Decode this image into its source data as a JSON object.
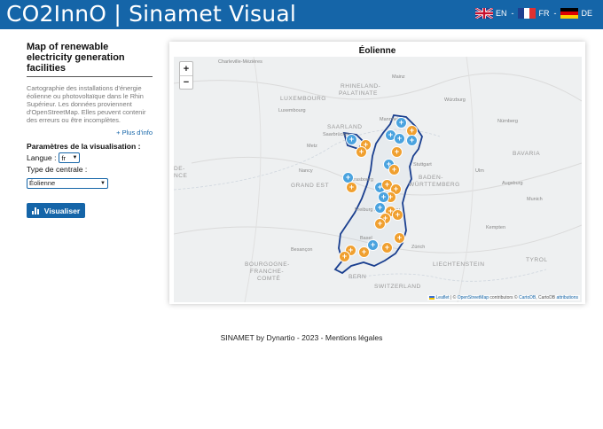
{
  "header": {
    "title": "CO2InnO | Sinamet Visual",
    "languages": [
      {
        "code": "EN",
        "flag": "uk-flag-icon"
      },
      {
        "code": "FR",
        "flag": "france-flag-icon"
      },
      {
        "code": "DE",
        "flag": "germany-flag-icon"
      }
    ],
    "separator": "-"
  },
  "sidebar": {
    "heading": "Map of renewable electricity generation facilities",
    "description": "Cartographie des installations d'énergie éolienne ou photovoltaïque dans le Rhin Supérieur. Les données proviennent d'OpenStreetMap. Elles peuvent contenir des erreurs ou être incomplètes.",
    "more_link": "+ Plus d'info",
    "params_title": "Paramètres de la visualisation :",
    "lang_label": "Langue :",
    "lang_value": "fr",
    "type_label": "Type de centrale :",
    "type_value": "Éolienne",
    "button_label": "Visualiser"
  },
  "map": {
    "title": "Éolienne",
    "zoom_in": "+",
    "zoom_out": "−",
    "labels": {
      "charleville": "Charleville-Mézières",
      "luxembourg_region": "LUXEMBOURG",
      "luxembourg": "Luxembourg",
      "rhineland": "RHINELAND-",
      "palatinate": "PALATINATE",
      "mainz": "Mainz",
      "wurzburg": "Würzburg",
      "saarland": "SAARLAND",
      "saarbrucken": "Saarbrücken",
      "nurnberg": "Nürnberg",
      "mannheim": "Mannheim",
      "metz": "Metz",
      "bavaria": "BAVARIA",
      "stuttgart": "Stuttgart",
      "nancy": "Nancy",
      "grand_est": "GRAND EST",
      "baden": "BADEN-",
      "wurttemberg": "WÜRTTEMBERG",
      "strasbourg": "Strasbourg",
      "augsburg": "Augsburg",
      "munich": "Munich",
      "freiburg": "Freiburg im Breisgau",
      "ulm": "Ulm",
      "kempten": "Kempten",
      "basel": "Basel",
      "zurich": "Zürich",
      "liechtenstein": "LIECHTENSTEIN",
      "bourgogne": "BOURGOGNE-",
      "franche": "FRANCHE-",
      "comte": "COMTÉ",
      "tyrol": "TYROL",
      "besancon": "Besançon",
      "bern": "BERN",
      "switzerland": "SWITZERLAND",
      "de_frag": "DE-",
      "ce_frag": "NCE"
    },
    "attribution": {
      "leaflet": "Leaflet",
      "sep1": " | © ",
      "osm": "OpenStreetMap",
      "mid": " contributors © ",
      "carto": "CartoDB",
      "sep2": ", CartoDB ",
      "attributions": "attributions"
    },
    "marker_colors": {
      "wind_orange": "#f0a030",
      "wind_blue": "#4aa3df"
    },
    "border_color": "#1a3f8f"
  },
  "footer": {
    "prefix": "SINAMET by ",
    "author": "Dynartio",
    "middle": " - 2023 - ",
    "legal": "Mentions légales"
  }
}
